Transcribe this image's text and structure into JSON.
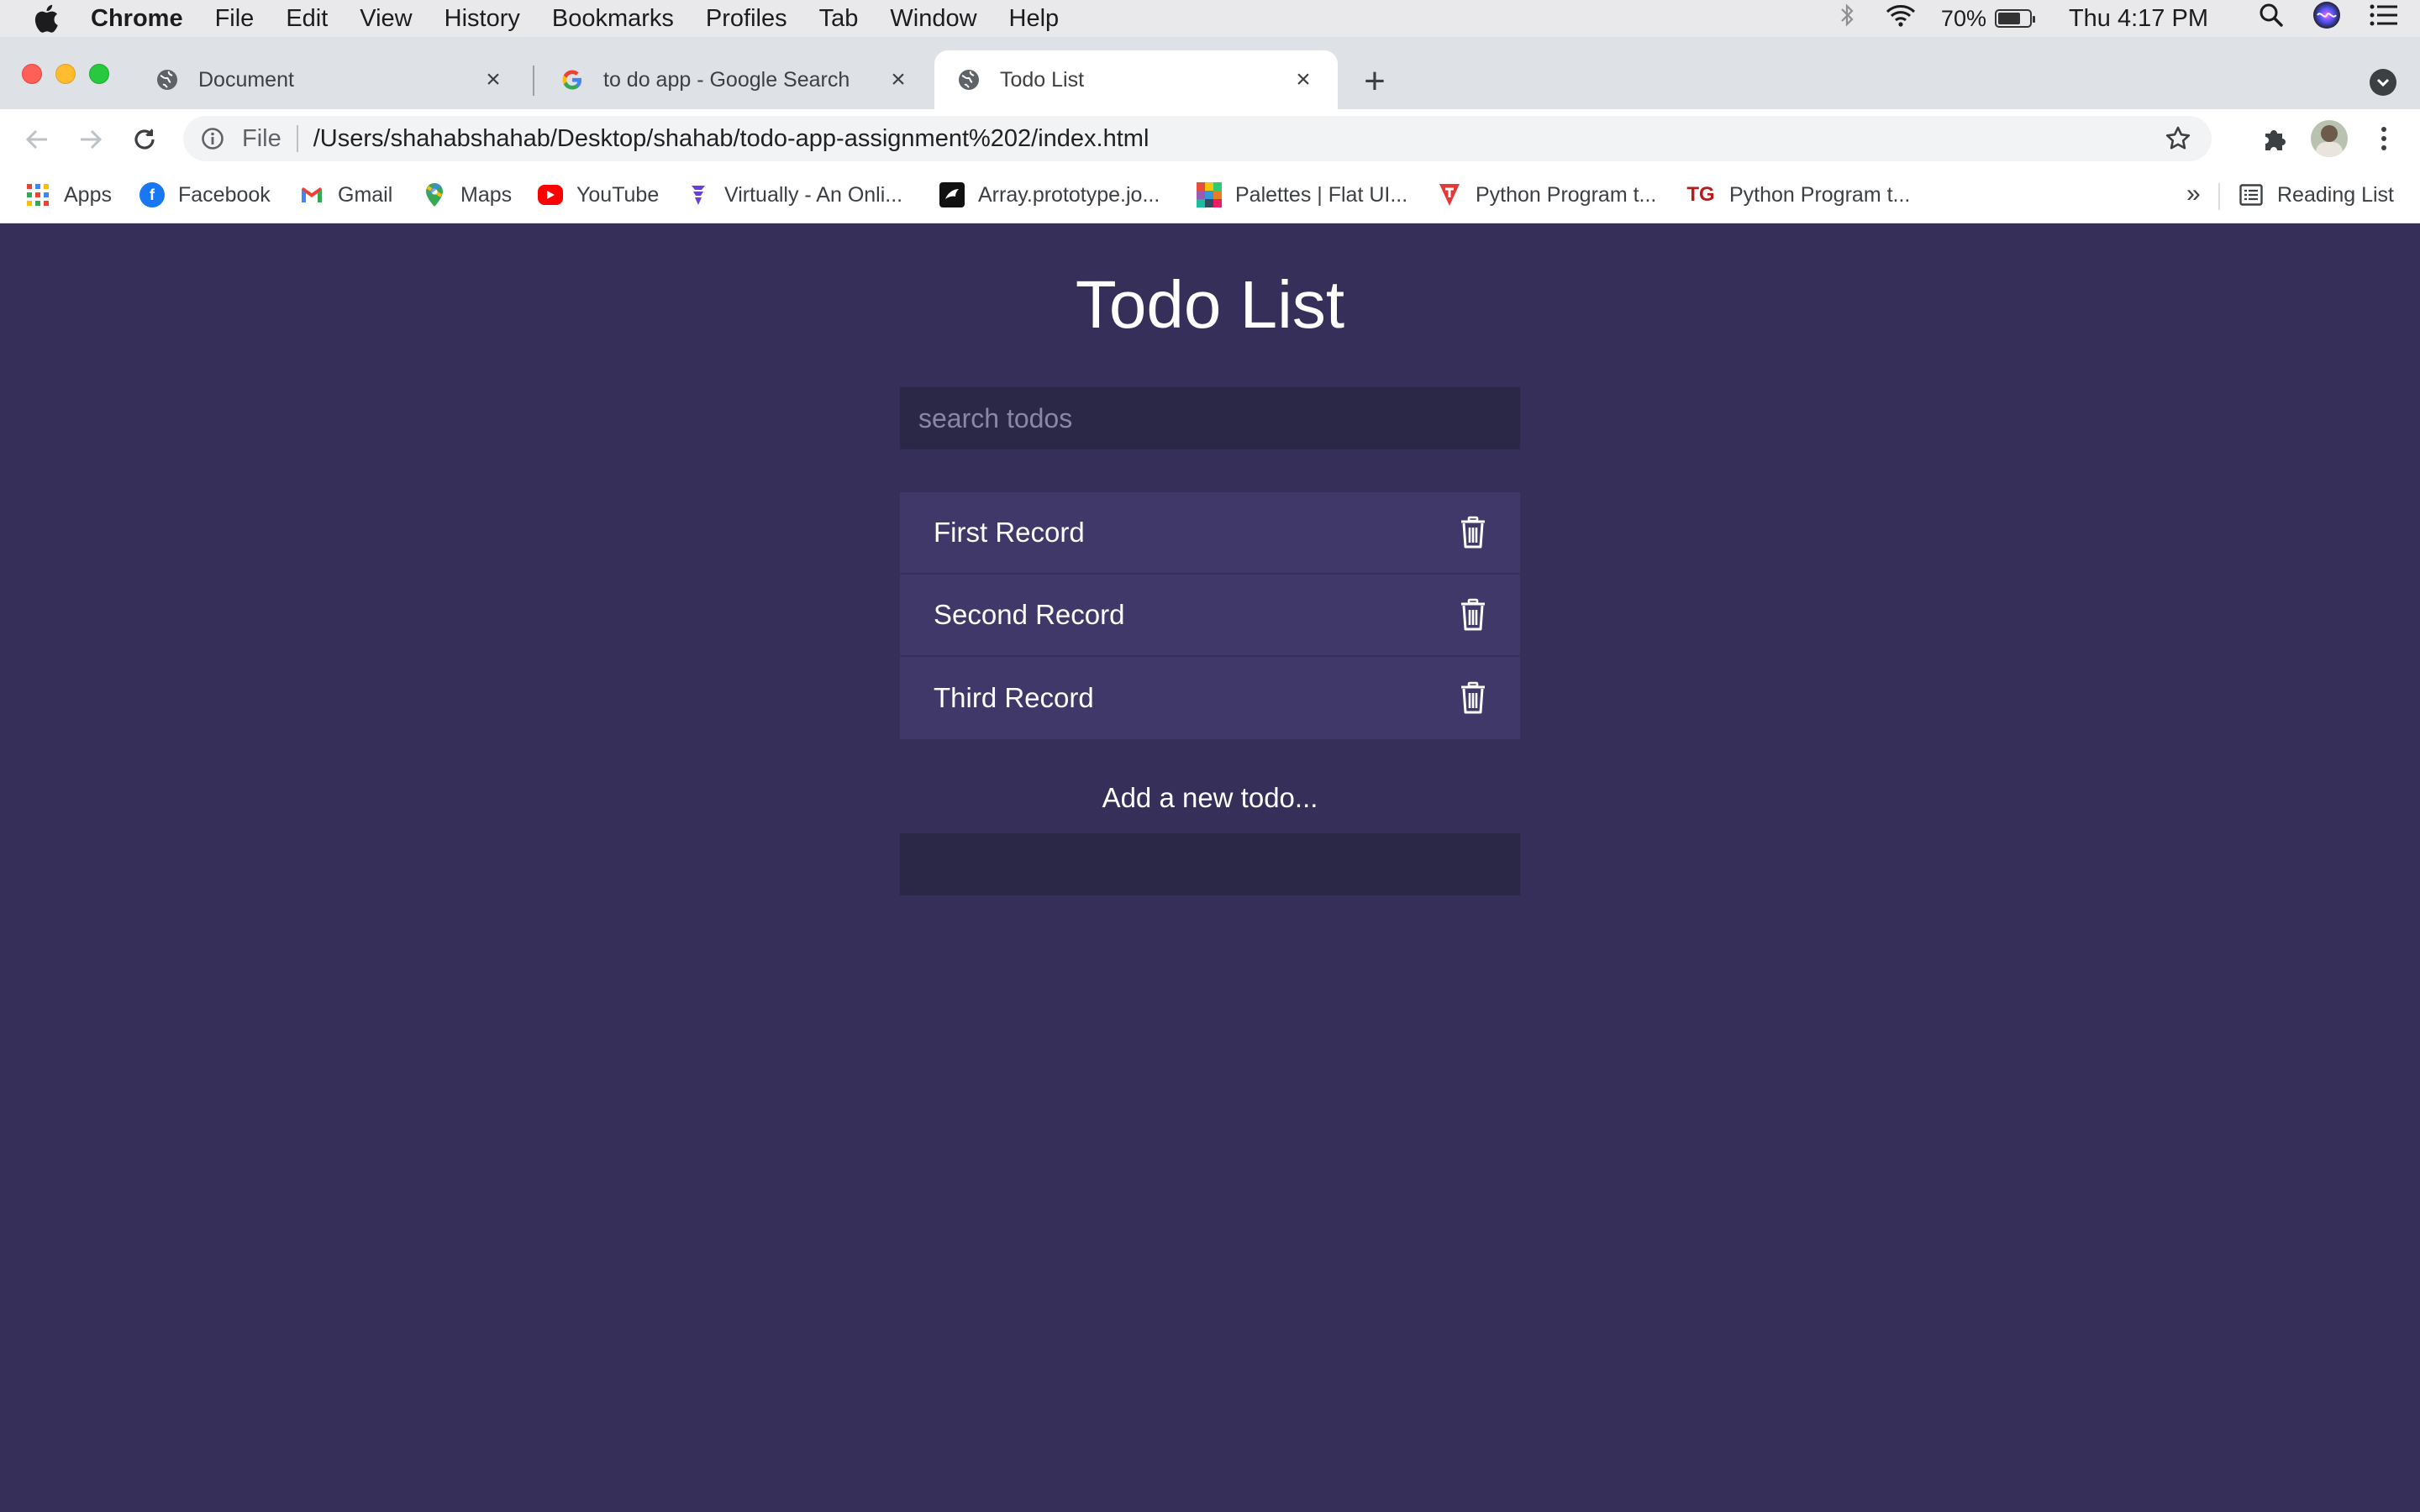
{
  "menubar": {
    "app_name": "Chrome",
    "items": [
      "File",
      "Edit",
      "View",
      "History",
      "Bookmarks",
      "Profiles",
      "Tab",
      "Window",
      "Help"
    ],
    "battery_percent": "70%",
    "clock": "Thu 4:17 PM"
  },
  "tabs": [
    {
      "title": "Document",
      "icon": "globe-icon"
    },
    {
      "title": "to do app - Google Search",
      "icon": "google-icon"
    },
    {
      "title": "Todo List",
      "icon": "globe-icon",
      "active": true
    }
  ],
  "omnibox": {
    "scheme": "File",
    "url": "/Users/shahabshahab/Desktop/shahab/todo-app-assignment%202/index.html"
  },
  "bookmarks": {
    "items": [
      {
        "label": "Apps",
        "icon": "apps-grid-icon"
      },
      {
        "label": "Facebook",
        "icon": "facebook-icon"
      },
      {
        "label": "Gmail",
        "icon": "gmail-icon"
      },
      {
        "label": "Maps",
        "icon": "maps-icon"
      },
      {
        "label": "YouTube",
        "icon": "youtube-icon"
      },
      {
        "label": "Virtually - An Onli...",
        "icon": "virtually-icon"
      },
      {
        "label": "Array.prototype.jo...",
        "icon": "mdn-icon"
      },
      {
        "label": "Palettes | Flat UI...",
        "icon": "flatui-icon"
      },
      {
        "label": "Python Program t...",
        "icon": "python-t-icon"
      },
      {
        "label": "Python Program t...",
        "icon": "tg-icon"
      }
    ],
    "more": "»",
    "reading_list": "Reading List"
  },
  "app": {
    "title": "Todo List",
    "search_placeholder": "search todos",
    "todos": [
      "First Record",
      "Second Record",
      "Third Record"
    ],
    "add_label": "Add a new todo...",
    "add_value": ""
  },
  "colors": {
    "page_bg": "#352f5a",
    "list_item_bg": "#403869",
    "input_bg": "#2b2847",
    "text": "#ffffff"
  }
}
